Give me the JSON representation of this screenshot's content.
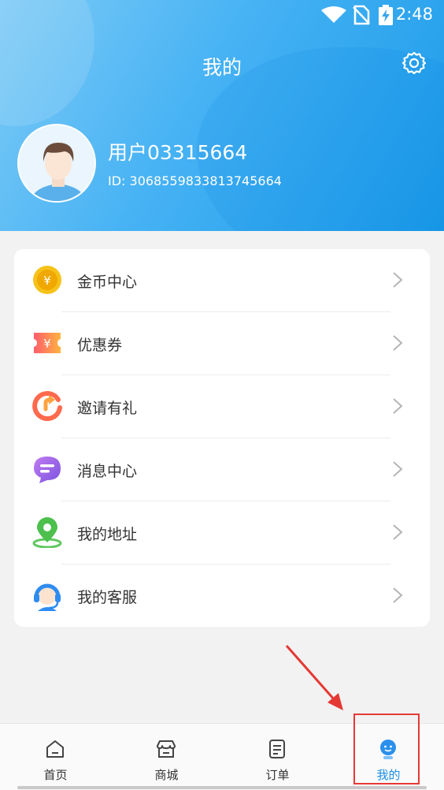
{
  "status_bar": {
    "time": "2:48",
    "icons": [
      "wifi-icon",
      "no-sim-icon",
      "battery-charging-icon"
    ]
  },
  "header": {
    "title": "我的",
    "settings_icon": "gear-icon"
  },
  "profile": {
    "username": "用户03315664",
    "user_id": "ID: 3068559833813745664",
    "avatar_icon": "user-avatar"
  },
  "menu": {
    "items": [
      {
        "label": "金币中心",
        "icon": "gold-coin-icon"
      },
      {
        "label": "优惠券",
        "icon": "coupon-icon"
      },
      {
        "label": "邀请有礼",
        "icon": "invite-icon"
      },
      {
        "label": "消息中心",
        "icon": "message-icon"
      },
      {
        "label": "我的地址",
        "icon": "location-pin-icon"
      },
      {
        "label": "我的客服",
        "icon": "customer-service-icon"
      }
    ]
  },
  "tabbar": {
    "tabs": [
      {
        "label": "首页",
        "icon": "home-icon",
        "active": false
      },
      {
        "label": "商城",
        "icon": "store-icon",
        "active": false
      },
      {
        "label": "订单",
        "icon": "order-icon",
        "active": false
      },
      {
        "label": "我的",
        "icon": "profile-icon",
        "active": true
      }
    ]
  },
  "colors": {
    "header_start": "#7ccaf6",
    "header_end": "#1a9ae8",
    "accent": "#1a8fe8",
    "annotation": "#e53935"
  }
}
